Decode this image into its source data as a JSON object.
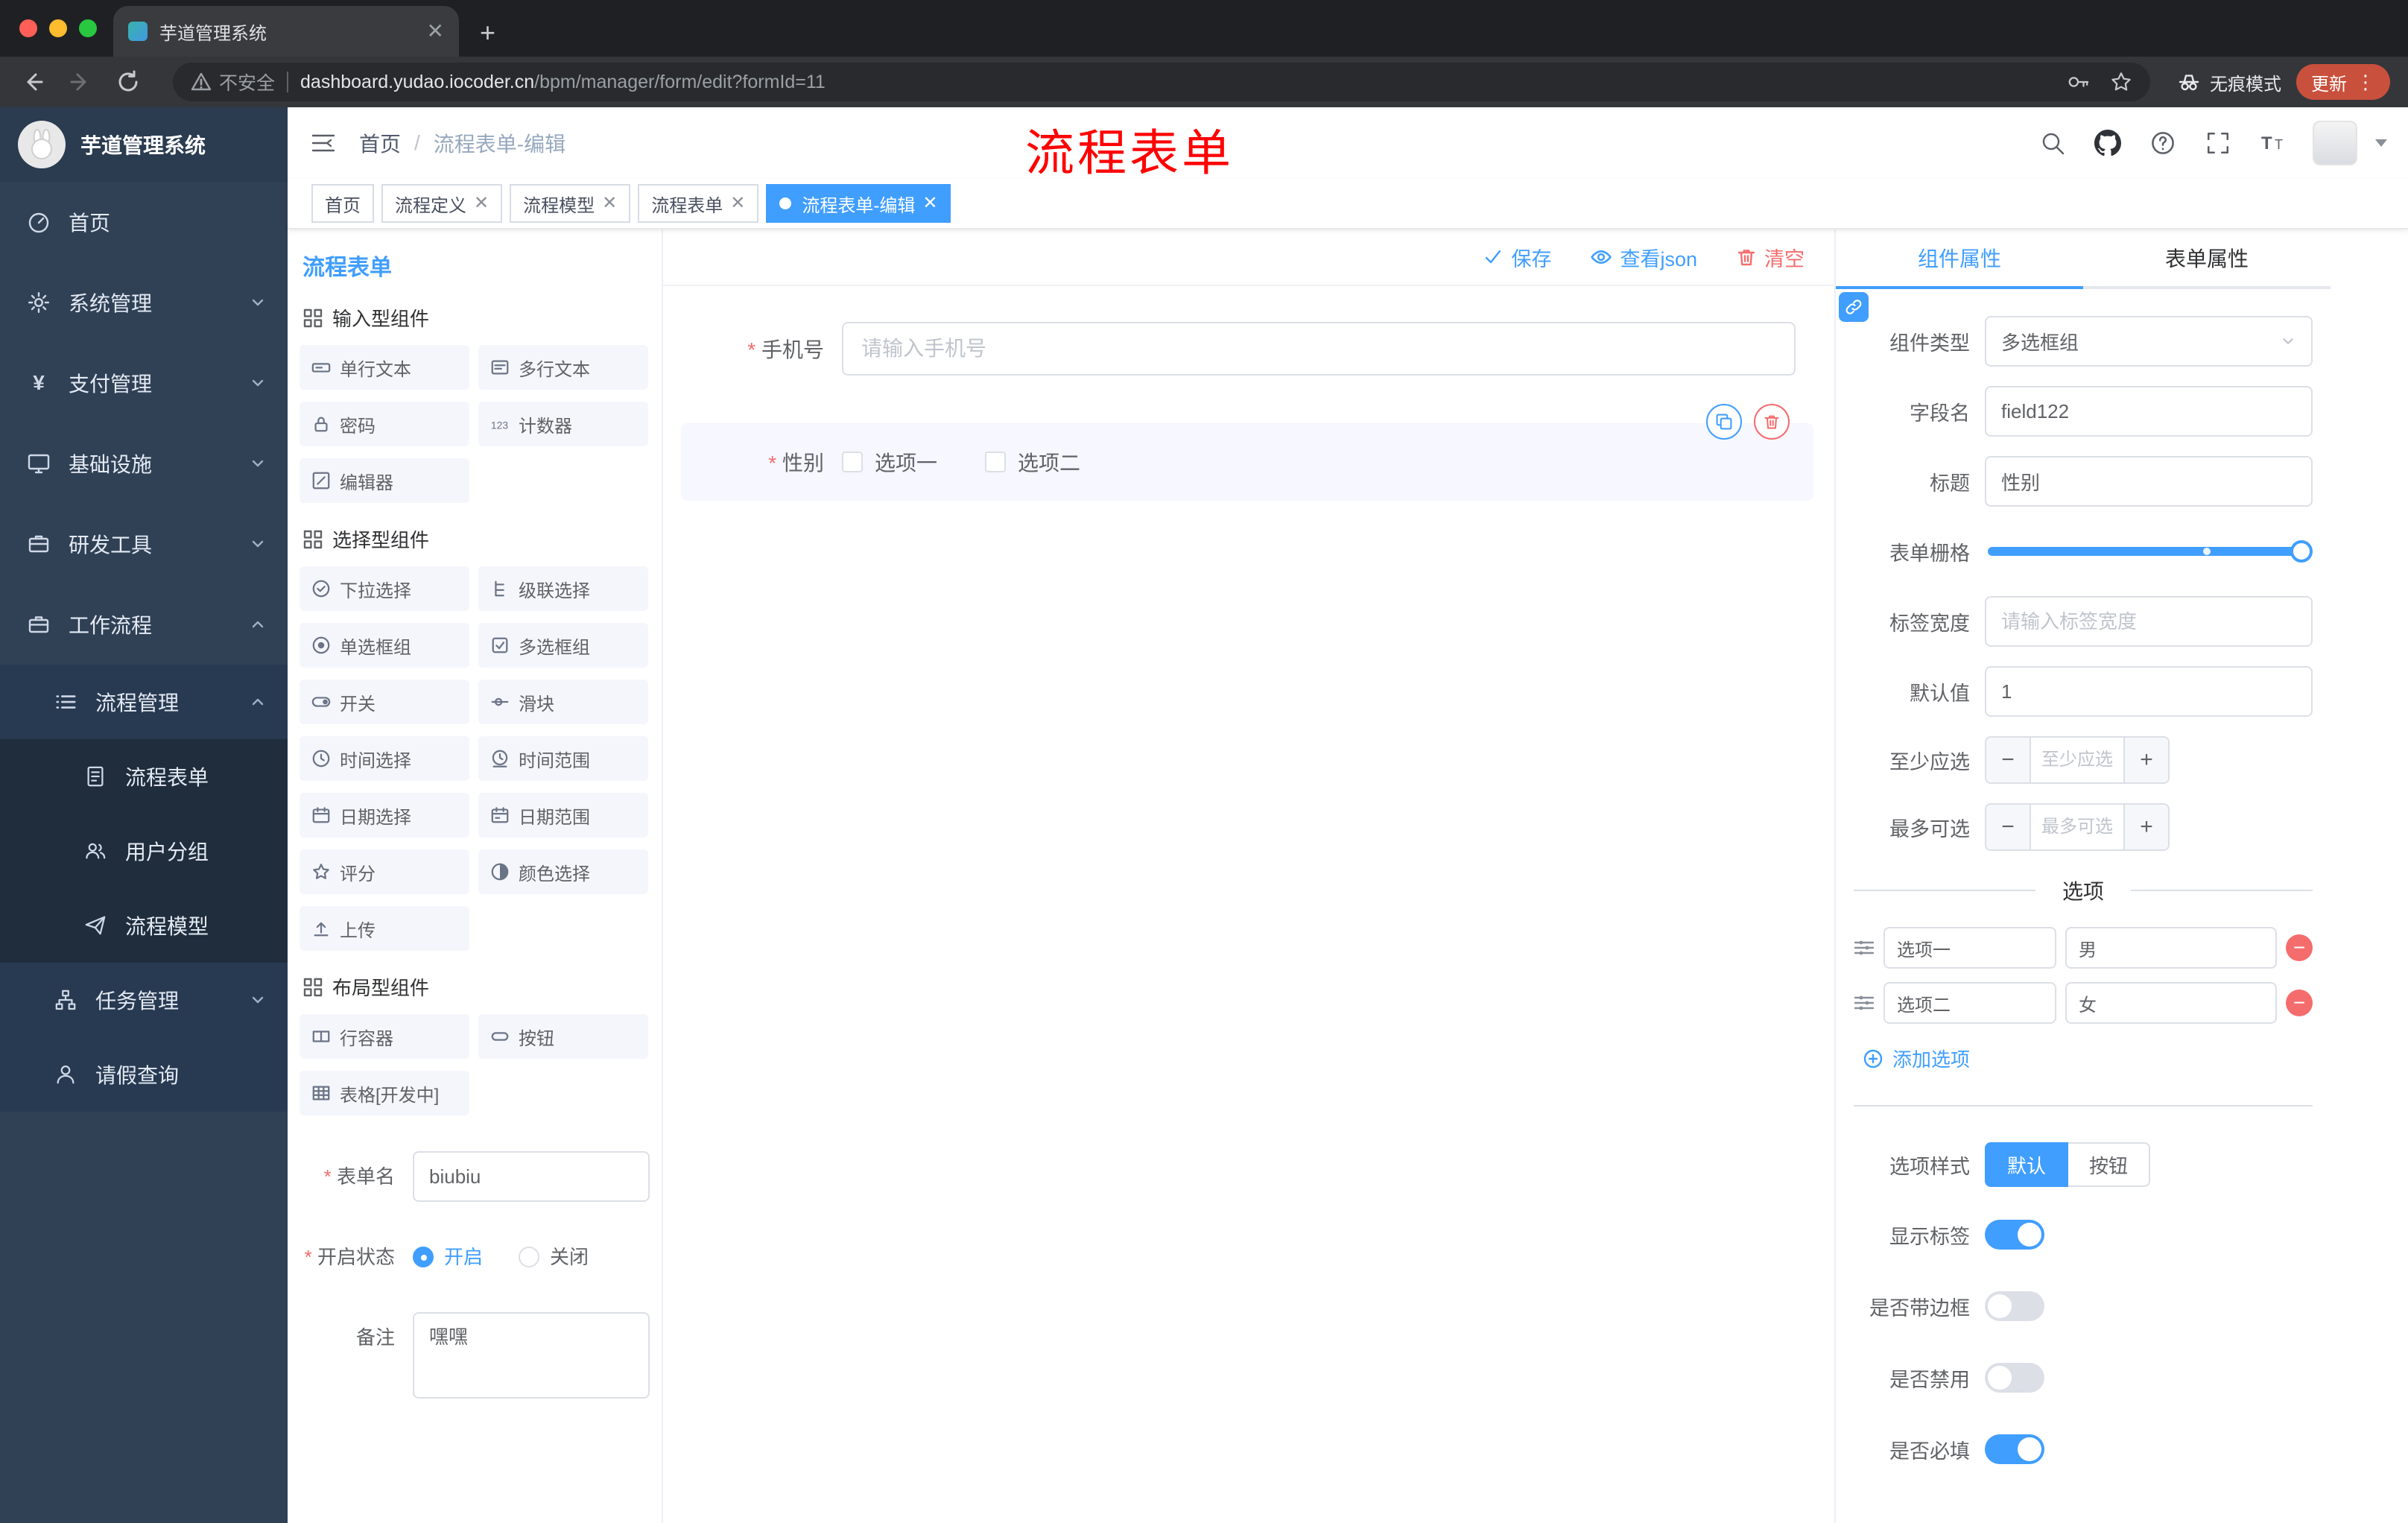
{
  "colors": {
    "primary": "#409eff",
    "danger": "#f56c6c",
    "sidebar_bg": "#304156"
  },
  "browser": {
    "tab_title": "芋道管理系统",
    "security_label": "不安全",
    "url_domain": "dashboard.yudao.iocoder.cn",
    "url_path": "/bpm/manager/form/edit?formId=11",
    "incognito_label": "无痕模式",
    "update_label": "更新"
  },
  "annotation": "流程表单",
  "sidebar": {
    "logo_title": "芋道管理系统",
    "menu": [
      {
        "label": "首页",
        "icon": "home-icon"
      },
      {
        "label": "系统管理",
        "icon": "gear-icon"
      },
      {
        "label": "支付管理",
        "icon": "yen-icon"
      },
      {
        "label": "基础设施",
        "icon": "monitor-icon"
      },
      {
        "label": "研发工具",
        "icon": "toolbox-icon"
      },
      {
        "label": "工作流程",
        "icon": "briefcase-icon"
      }
    ],
    "process_group": {
      "label": "流程管理",
      "icon": "list-icon"
    },
    "process_children": [
      {
        "label": "流程表单",
        "icon": "document-icon"
      },
      {
        "label": "用户分组",
        "icon": "users-icon"
      },
      {
        "label": "流程模型",
        "icon": "send-icon"
      }
    ],
    "tail": [
      {
        "label": "任务管理",
        "icon": "tree-icon"
      },
      {
        "label": "请假查询",
        "icon": "user-icon"
      }
    ]
  },
  "header": {
    "breadcrumb": {
      "home": "首页",
      "current": "流程表单-编辑"
    }
  },
  "tags": [
    {
      "label": "首页"
    },
    {
      "label": "流程定义"
    },
    {
      "label": "流程模型"
    },
    {
      "label": "流程表单"
    },
    {
      "label": "流程表单-编辑"
    }
  ],
  "designer": {
    "panel_title": "流程表单",
    "toolbar": {
      "save": "保存",
      "view_json": "查看json",
      "clear": "清空"
    },
    "palette": {
      "sections": [
        {
          "title": "输入型组件",
          "items": [
            {
              "label": "单行文本",
              "icon": "input-icon"
            },
            {
              "label": "多行文本",
              "icon": "textarea-icon"
            },
            {
              "label": "密码",
              "icon": "lock-icon"
            },
            {
              "label": "计数器",
              "icon": "counter-icon"
            },
            {
              "label": "编辑器",
              "icon": "editor-icon"
            }
          ]
        },
        {
          "title": "选择型组件",
          "items": [
            {
              "label": "下拉选择",
              "icon": "select-icon"
            },
            {
              "label": "级联选择",
              "icon": "cascader-icon"
            },
            {
              "label": "单选框组",
              "icon": "radio-icon"
            },
            {
              "label": "多选框组",
              "icon": "checkbox-icon"
            },
            {
              "label": "开关",
              "icon": "switch-icon"
            },
            {
              "label": "滑块",
              "icon": "slider-icon"
            },
            {
              "label": "时间选择",
              "icon": "time-icon"
            },
            {
              "label": "时间范围",
              "icon": "time-range-icon"
            },
            {
              "label": "日期选择",
              "icon": "date-icon"
            },
            {
              "label": "日期范围",
              "icon": "date-range-icon"
            },
            {
              "label": "评分",
              "icon": "star-icon"
            },
            {
              "label": "颜色选择",
              "icon": "color-icon"
            },
            {
              "label": "上传",
              "icon": "upload-icon"
            }
          ]
        },
        {
          "title": "布局型组件",
          "items": [
            {
              "label": "行容器",
              "icon": "row-container-icon"
            },
            {
              "label": "按钮",
              "icon": "button-icon"
            },
            {
              "label": "表格[开发中]",
              "icon": "table-icon"
            }
          ]
        }
      ]
    },
    "meta_form": {
      "name_label": "表单名",
      "name_value": "biubiu",
      "status_label": "开启状态",
      "status_on": "开启",
      "status_off": "关闭",
      "remark_label": "备注",
      "remark_value": "嘿嘿"
    },
    "canvas": {
      "phone": {
        "label": "手机号",
        "placeholder": "请输入手机号"
      },
      "gender": {
        "label": "性别",
        "option1": "选项一",
        "option2": "选项二"
      }
    }
  },
  "props": {
    "tabs": {
      "component": "组件属性",
      "form": "表单属性"
    },
    "fields": {
      "type_label": "组件类型",
      "type_value": "多选框组",
      "name_label": "字段名",
      "name_value": "field122",
      "title_label": "标题",
      "title_value": "性别",
      "grid_label": "表单栅格",
      "label_width_label": "标签宽度",
      "label_width_placeholder": "请输入标签宽度",
      "default_label": "默认值",
      "default_value": "1",
      "min_label": "至少应选",
      "min_placeholder": "至少应选",
      "max_label": "最多可选",
      "max_placeholder": "最多可选"
    },
    "options": {
      "divider_title": "选项",
      "rows": [
        {
          "name": "选项一",
          "value": "男"
        },
        {
          "name": "选项二",
          "value": "女"
        }
      ],
      "add_label": "添加选项"
    },
    "option_style": {
      "label": "选项样式",
      "opt_default": "默认",
      "opt_button": "按钮"
    },
    "switches": [
      {
        "label": "显示标签",
        "on": true
      },
      {
        "label": "是否带边框",
        "on": false
      },
      {
        "label": "是否禁用",
        "on": false
      },
      {
        "label": "是否必填",
        "on": true
      }
    ]
  }
}
